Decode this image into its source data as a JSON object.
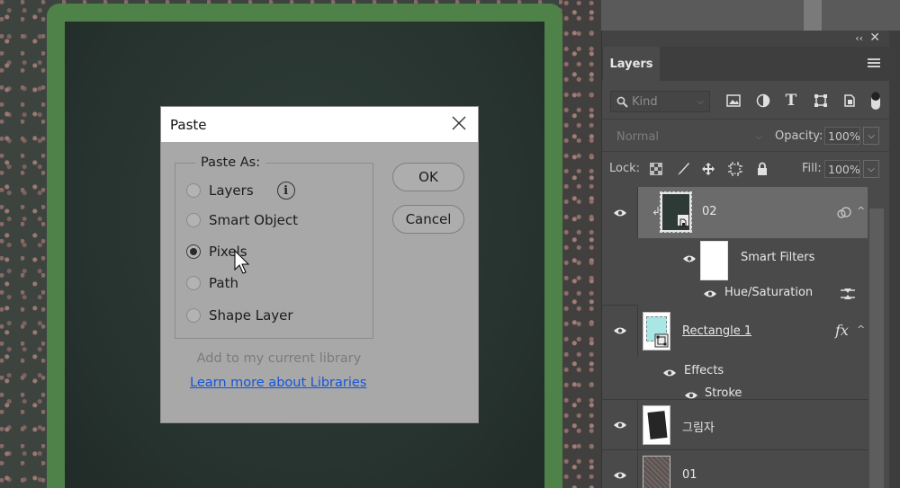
{
  "dialog": {
    "title": "Paste",
    "group_label": "Paste As:",
    "options": [
      {
        "label": "Layers",
        "checked": false
      },
      {
        "label": "Smart Object",
        "checked": false
      },
      {
        "label": "Pixels",
        "checked": true
      },
      {
        "label": "Path",
        "checked": false
      },
      {
        "label": "Shape Layer",
        "checked": false
      }
    ],
    "ok_label": "OK",
    "cancel_label": "Cancel",
    "add_library_text": "Add to my current library",
    "learn_more_link": "Learn more about Libraries"
  },
  "layers_panel": {
    "tab_label": "Layers",
    "filter": {
      "kind_label": "Kind"
    },
    "blend_mode": "Normal",
    "opacity_label": "Opacity:",
    "opacity_value": "100%",
    "lock_label": "Lock:",
    "fill_label": "Fill:",
    "fill_value": "100%",
    "layers": [
      {
        "name": "02",
        "smart_filters_label": "Smart Filters",
        "filter_name": "Hue/Saturation"
      },
      {
        "name": "Rectangle 1",
        "fx_label": "fx",
        "effects_label": "Effects",
        "effect_name": "Stroke"
      },
      {
        "name": "그림자"
      },
      {
        "name": "01"
      }
    ]
  },
  "colors": {
    "frame_green": "#4f8249",
    "board": "#2b3833",
    "dialog_bg": "#a8a8a8",
    "link": "#1455d9",
    "panel_bg": "#4a4a4a",
    "selected_layer": "#6b6b6b"
  }
}
